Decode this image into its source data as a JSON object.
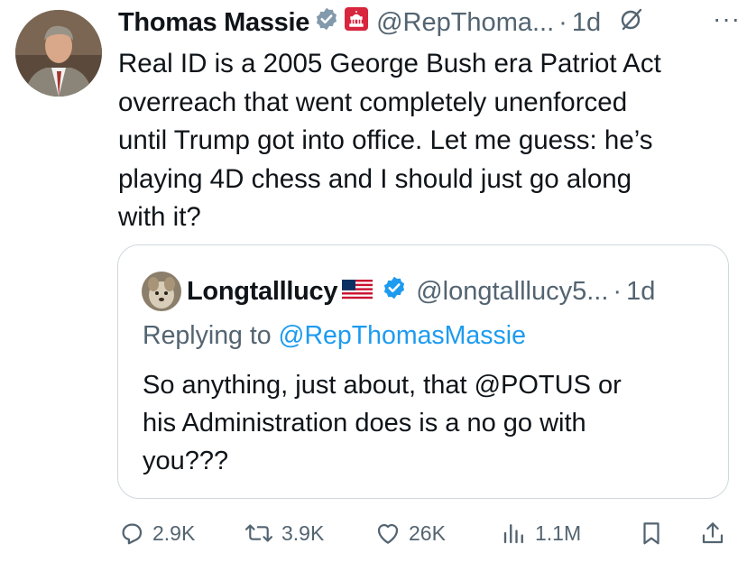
{
  "tweet": {
    "author_name": "Thomas Massie",
    "handle": "@RepThoma...",
    "separator": "·",
    "time": "1d",
    "more": "···",
    "text_lines": [
      "Real ID is a 2005 George Bush era Patriot Act",
      "overreach that went completely unenforced",
      "until Trump got into office. Let me guess: he’s",
      "playing 4D chess and I should just go along",
      "with it?"
    ]
  },
  "quote": {
    "author_name": "Longtalllucy",
    "handle": "@longtalllucy5...",
    "separator": "·",
    "time": "1d",
    "replying_prefix": "Replying to",
    "replying_handle": "@RepThomasMassie",
    "text_lines": [
      "So anything,  just about, that @POTUS or",
      "his Administration does is a no go with",
      "you???"
    ]
  },
  "actions": {
    "replies": "2.9K",
    "reposts": "3.9K",
    "likes": "26K",
    "views": "1.1M"
  },
  "icons": {
    "verified": "verified-badge-icon",
    "government": "capitol-badge-icon",
    "grok": "grok-icon",
    "flag": "us-flag-icon",
    "reply": "reply-icon",
    "repost": "repost-icon",
    "like": "heart-icon",
    "views": "views-icon",
    "bookmark": "bookmark-icon",
    "share": "share-icon"
  },
  "colors": {
    "text": "#0f1419",
    "secondary": "#536471",
    "link": "#1d9bf0",
    "verified": "#1d9bf0",
    "border": "#cfd9de"
  }
}
